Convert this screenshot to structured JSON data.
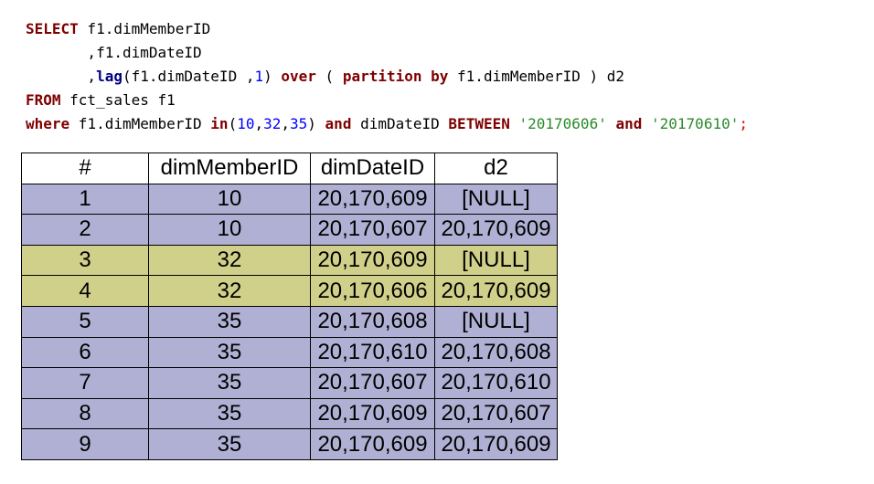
{
  "sql": {
    "select_kw": "SELECT",
    "line1_rest": " f1.dimMemberID",
    "line2": "       ,f1.dimDateID",
    "line3_prefix": "       ,",
    "lag_kw": "lag",
    "line3_a": "(f1.dimDateID ,",
    "lag_offset": "1",
    "line3_b": ") ",
    "over_kw": "over",
    "line3_c": " ( ",
    "partition_kw": "partition by",
    "line3_d": " f1.dimMemberID ) d2",
    "from_kw": "FROM",
    "line4_rest": " fct_sales f1",
    "where_kw": "where",
    "line5_a": " f1.dimMemberID ",
    "in_kw": "in",
    "line5_paren": "(",
    "in_v1": "10",
    "comma1": ",",
    "in_v2": "32",
    "comma2": ",",
    "in_v3": "35",
    "line5_close": ") ",
    "and_kw1": "and",
    "line5_b": " dimDateID ",
    "between_kw": "BETWEEN",
    "line5_sp": " ",
    "date_from": "'20170606'",
    "line5_sp2": " ",
    "and_kw2": "and",
    "line5_sp3": " ",
    "date_to": "'20170610'",
    "semicolon": ";"
  },
  "table": {
    "headers": [
      "#",
      "dimMemberID",
      "dimDateID",
      "d2"
    ],
    "rows": [
      {
        "n": "1",
        "member": "10",
        "date": "20,170,609",
        "d2": "[NULL]",
        "group": "purple"
      },
      {
        "n": "2",
        "member": "10",
        "date": "20,170,607",
        "d2": "20,170,609",
        "group": "purple"
      },
      {
        "n": "3",
        "member": "32",
        "date": "20,170,609",
        "d2": "[NULL]",
        "group": "olive"
      },
      {
        "n": "4",
        "member": "32",
        "date": "20,170,606",
        "d2": "20,170,609",
        "group": "olive"
      },
      {
        "n": "5",
        "member": "35",
        "date": "20,170,608",
        "d2": "[NULL]",
        "group": "purple"
      },
      {
        "n": "6",
        "member": "35",
        "date": "20,170,610",
        "d2": "20,170,608",
        "group": "purple"
      },
      {
        "n": "7",
        "member": "35",
        "date": "20,170,607",
        "d2": "20,170,610",
        "group": "purple"
      },
      {
        "n": "8",
        "member": "35",
        "date": "20,170,609",
        "d2": "20,170,607",
        "group": "purple"
      },
      {
        "n": "9",
        "member": "35",
        "date": "20,170,609",
        "d2": "20,170,609",
        "group": "purple"
      }
    ]
  },
  "colors": {
    "keyword": "#7f0000",
    "function": "#00007f",
    "number": "#0000ff",
    "string": "#2a8a2a",
    "row_purple": "#b0b0d4",
    "row_olive": "#d0d08a"
  }
}
